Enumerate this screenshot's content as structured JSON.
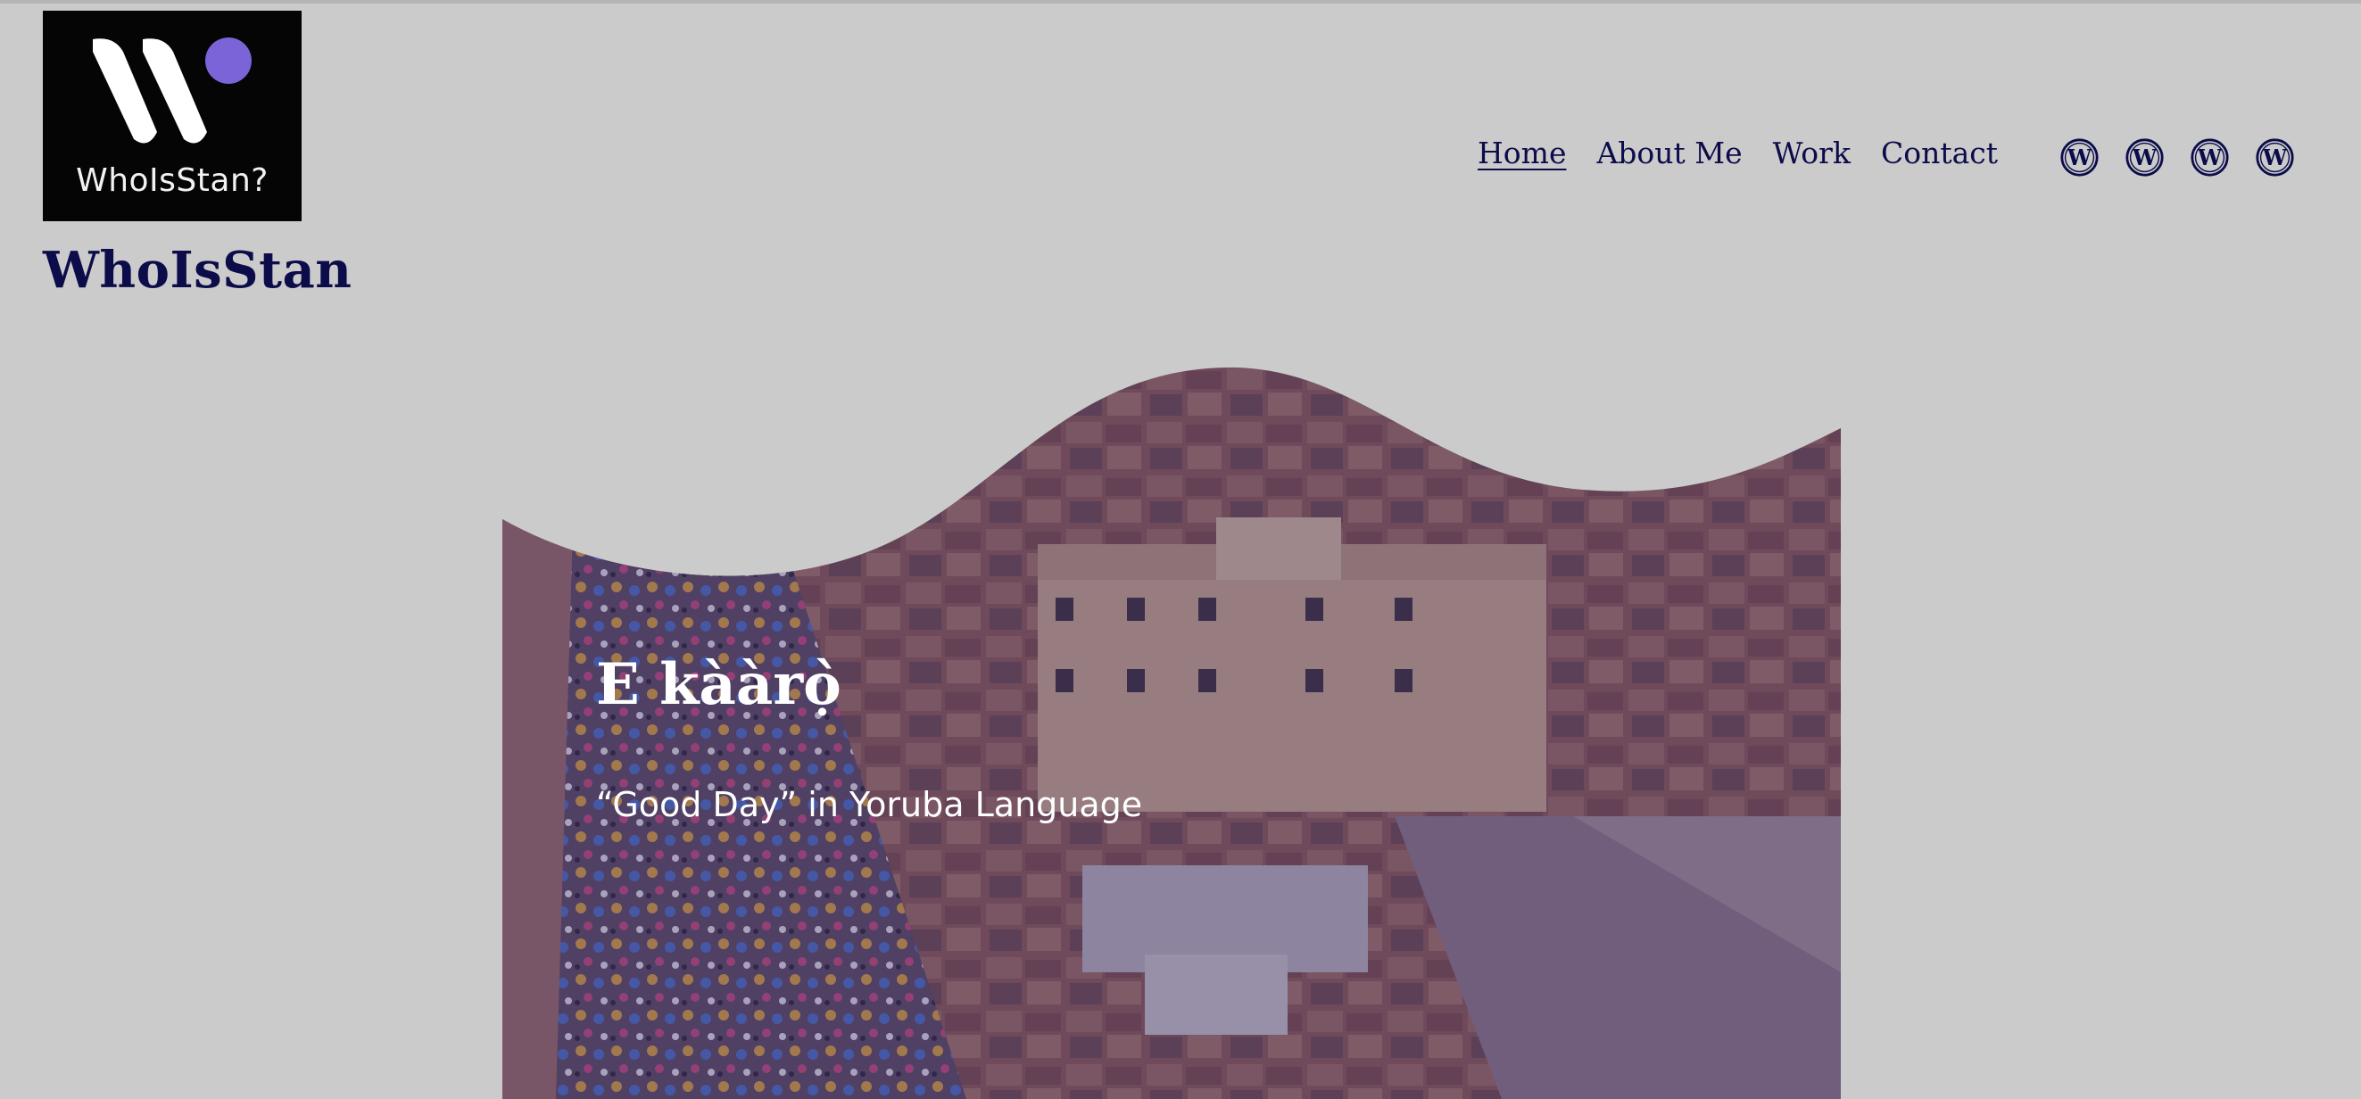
{
  "header": {
    "logo": {
      "text": "WhoIsStan?",
      "icon": "whoisstan-logo-mark",
      "bg": "#050505",
      "dot_color": "#7b63d8"
    },
    "site_title": "WhoIsStan"
  },
  "nav": {
    "items": [
      {
        "label": "Home",
        "current": true
      },
      {
        "label": "About Me",
        "current": false
      },
      {
        "label": "Work",
        "current": false
      },
      {
        "label": "Contact",
        "current": false
      }
    ]
  },
  "social": {
    "icons": [
      "wordpress-icon",
      "wordpress-icon",
      "wordpress-icon",
      "wordpress-icon"
    ]
  },
  "hero": {
    "heading": "E kààrọ̀",
    "subtitle": "“Good Day” in Yoruba Language",
    "image": "aerial-market-scene",
    "overlay_color": "#3c2e6e"
  },
  "colors": {
    "background": "#cbcbcb",
    "text": "#0c0c4a"
  }
}
